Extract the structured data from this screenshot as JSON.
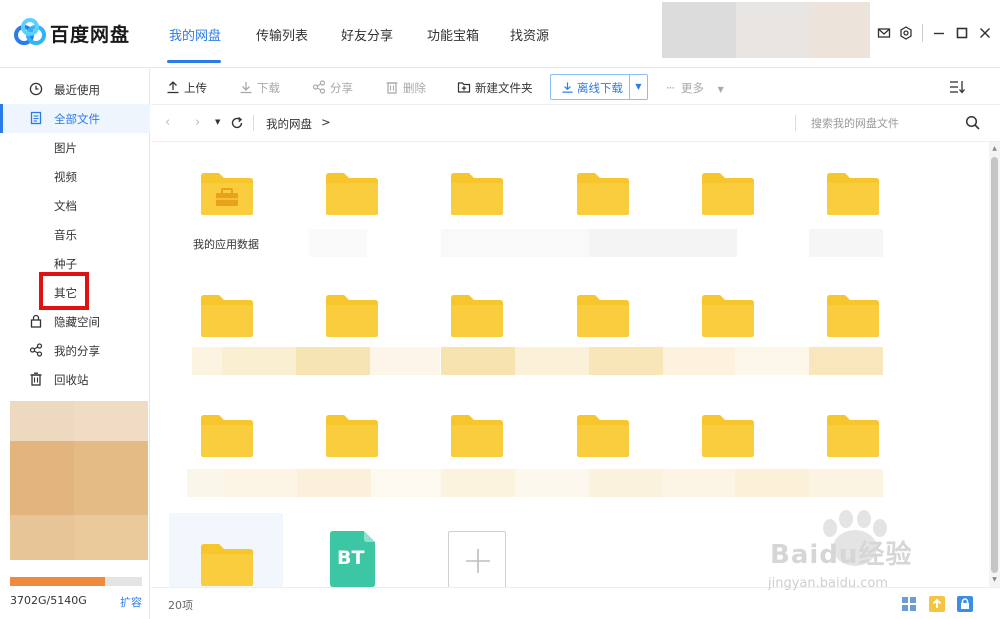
{
  "app": {
    "title": "百度网盘",
    "colors": {
      "accent": "#2b7ce9",
      "folder": "#f7c52c",
      "highlight": "#e01111",
      "quota": "#f08a3c"
    }
  },
  "nav": {
    "tabs": [
      {
        "label": "我的网盘",
        "active": true
      },
      {
        "label": "传输列表"
      },
      {
        "label": "好友分享"
      },
      {
        "label": "功能宝箱"
      },
      {
        "label": "找资源"
      }
    ]
  },
  "window_icons": [
    "mail-icon",
    "settings-icon",
    "minimize-icon",
    "maximize-icon",
    "close-icon"
  ],
  "sidebar": {
    "items": [
      {
        "label": "最近使用",
        "icon": "clock-icon"
      },
      {
        "label": "全部文件",
        "icon": "document-icon",
        "active": true
      },
      {
        "label": "图片"
      },
      {
        "label": "视频"
      },
      {
        "label": "文档"
      },
      {
        "label": "音乐"
      },
      {
        "label": "种子"
      },
      {
        "label": "其它",
        "highlighted": true
      },
      {
        "label": "隐藏空间",
        "icon": "lock-icon"
      },
      {
        "label": "我的分享",
        "icon": "share-icon"
      },
      {
        "label": "回收站",
        "icon": "trash-icon"
      }
    ],
    "quota": {
      "text": "3702G/5140G",
      "used_fraction": 0.72,
      "expand_label": "扩容"
    }
  },
  "toolbar": {
    "upload": "上传",
    "download": "下载",
    "share": "分享",
    "delete": "删除",
    "new_folder": "新建文件夹",
    "offline_download": "离线下载",
    "more": "更多"
  },
  "addressbar": {
    "breadcrumb": "我的网盘",
    "separator": ">",
    "search_placeholder": "搜索我的网盘文件"
  },
  "files": {
    "first_folder_name": "我的应用数据",
    "bt_label": "BT"
  },
  "status": {
    "item_count": "20项"
  },
  "watermark": {
    "text": "Baidu经验",
    "url": "jingyan.baidu.com"
  }
}
